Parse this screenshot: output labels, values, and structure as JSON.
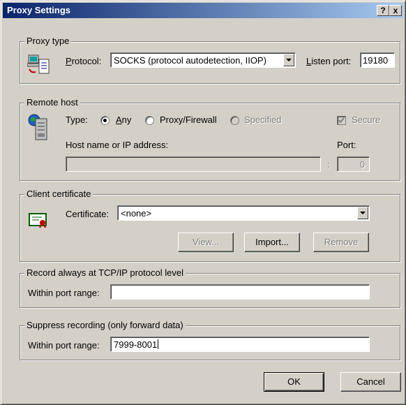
{
  "window": {
    "title": "Proxy Settings",
    "help_button": "?",
    "close_button": "x"
  },
  "proxy_type": {
    "legend": "Proxy type",
    "protocol_label": "Protocol:",
    "protocol_value": "SOCKS (protocol autodetection, IIOP)",
    "listen_port_label": "Listen port:",
    "listen_port_value": "19180"
  },
  "remote_host": {
    "legend": "Remote host",
    "type_label": "Type:",
    "options": {
      "any": "Any",
      "proxy_firewall": "Proxy/Firewall",
      "specified": "Specified"
    },
    "selected": "any",
    "secure_label": "Secure",
    "host_label": "Host name or IP address:",
    "host_value": "",
    "port_label": "Port:",
    "port_separator": ":",
    "port_value": "0"
  },
  "client_certificate": {
    "legend": "Client certificate",
    "certificate_label": "Certificate:",
    "certificate_value": "<none>",
    "view_label": "View...",
    "import_label": "Import...",
    "remove_label": "Remove"
  },
  "record_tcp": {
    "legend": "Record always at TCP/IP protocol level",
    "range_label": "Within port range:",
    "range_value": ""
  },
  "suppress": {
    "legend": "Suppress recording (only forward data)",
    "range_label": "Within port range:",
    "range_value": "7999-8001"
  },
  "footer": {
    "ok_label": "OK",
    "cancel_label": "Cancel"
  }
}
